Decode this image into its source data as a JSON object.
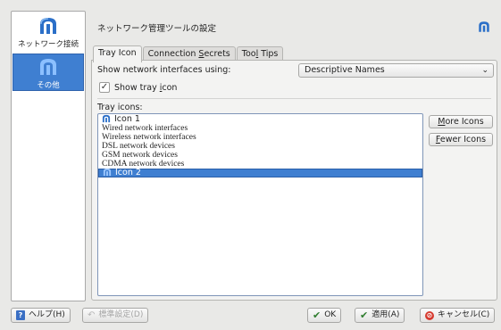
{
  "sidebar": {
    "items": [
      {
        "label": "ネットワーク接続",
        "icon": "network-manager-icon",
        "selected": false
      },
      {
        "label": "その他",
        "icon": "network-manager-icon",
        "selected": true
      }
    ]
  },
  "header": {
    "title": "ネットワーク管理ツールの設定",
    "icon": "network-manager-icon"
  },
  "tabs": [
    {
      "label_pre": "Tray Icon",
      "label_u": "",
      "label_post": "",
      "active": true
    },
    {
      "label_pre": "Connection ",
      "label_u": "S",
      "label_post": "ecrets",
      "active": false
    },
    {
      "label_pre": "Too",
      "label_u": "l",
      "label_post": " Tips",
      "active": false
    }
  ],
  "tray_icon": {
    "show_using_label": "Show network interfaces using:",
    "show_using_value": "Descriptive Names",
    "show_tray_icon_pre": "Show tray ",
    "show_tray_icon_u": "i",
    "show_tray_icon_post": "con",
    "show_tray_icon_checked": true,
    "tray_icons_label": "Tray icons:",
    "list": [
      {
        "text": "Icon 1",
        "type": "icon",
        "selected": false
      },
      {
        "text": "Wired network interfaces",
        "type": "item",
        "selected": false
      },
      {
        "text": "Wireless network interfaces",
        "type": "item",
        "selected": false
      },
      {
        "text": "DSL network devices",
        "type": "item",
        "selected": false
      },
      {
        "text": "GSM network devices",
        "type": "item",
        "selected": false
      },
      {
        "text": "CDMA network devices",
        "type": "item",
        "selected": false
      },
      {
        "text": "Icon 2",
        "type": "icon",
        "selected": true
      }
    ],
    "more_icons_pre": "",
    "more_icons_u": "M",
    "more_icons_post": "ore Icons",
    "fewer_icons_pre": "",
    "fewer_icons_u": "F",
    "fewer_icons_post": "ewer Icons"
  },
  "buttons": {
    "help": "ヘルプ(H)",
    "defaults": "標準設定(D)",
    "ok": "OK",
    "apply": "適用(A)",
    "cancel": "キャンセル(C)"
  },
  "colors": {
    "selection": "#3f7fd1",
    "icon_blue": "#2b6fc8"
  }
}
